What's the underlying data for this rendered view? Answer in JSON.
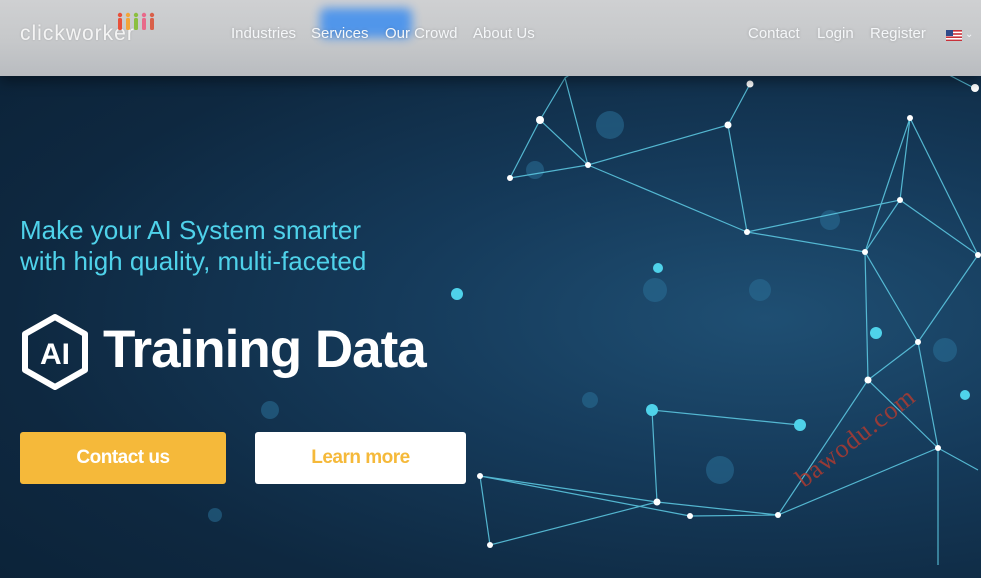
{
  "header": {
    "logo_text": "clickworker",
    "nav": [
      "Industries",
      "Services",
      "Our Crowd",
      "About Us"
    ],
    "right_links": [
      "Contact",
      "Login",
      "Register"
    ],
    "language_flag": "us-flag-icon"
  },
  "hero": {
    "tagline_line1": "Make your AI System smarter",
    "tagline_line2": "with high quality, multi-faceted",
    "badge_text": "AI",
    "title": "Training Data",
    "contact_button": "Contact us",
    "learn_button": "Learn more"
  },
  "watermark": "bawodu.com",
  "colors": {
    "accent_cyan": "#4fd2ea",
    "button_yellow": "#f5b93a",
    "background_navy": "#0f2a44"
  }
}
